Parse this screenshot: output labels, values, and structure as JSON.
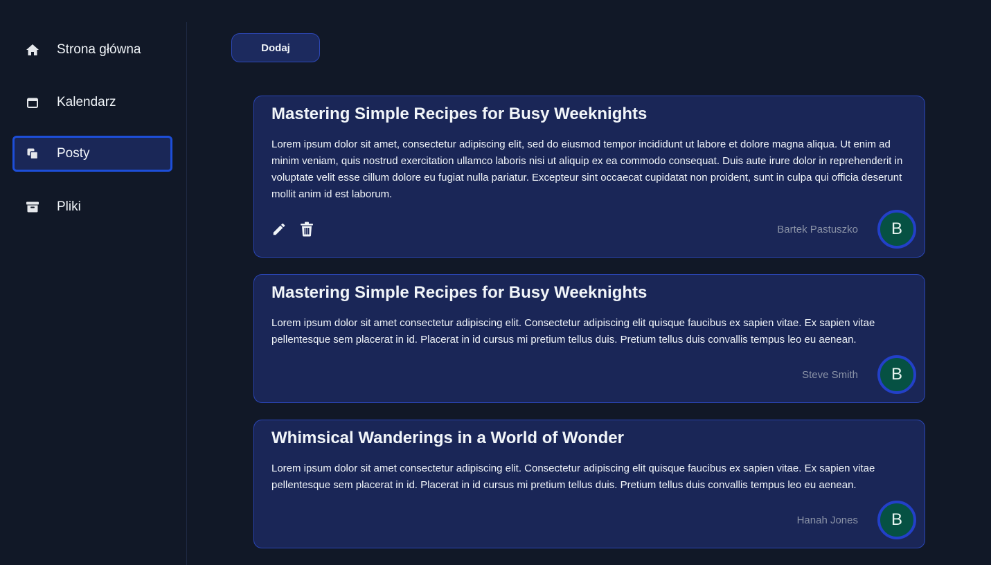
{
  "sidebar": {
    "items": [
      {
        "label": "Strona główna",
        "icon": "home-icon"
      },
      {
        "label": "Kalendarz",
        "icon": "calendar-icon"
      },
      {
        "label": "Posty",
        "icon": "copy-icon",
        "active": true
      },
      {
        "label": "Pliki",
        "icon": "archive-icon"
      }
    ]
  },
  "toolbar": {
    "add_label": "Dodaj"
  },
  "posts": [
    {
      "title": "Mastering Simple Recipes for Busy Weeknights",
      "body": "Lorem ipsum dolor sit amet, consectetur adipiscing elit, sed do eiusmod tempor incididunt ut labore et dolore magna aliqua. Ut enim ad minim veniam, quis nostrud exercitation ullamco laboris nisi ut aliquip ex ea commodo consequat. Duis aute irure dolor in reprehenderit in voluptate velit esse cillum dolore eu fugiat nulla pariatur. Excepteur sint occaecat cupidatat non proident, sunt in culpa qui officia deserunt mollit anim id est laborum.",
      "author": "Bartek Pastuszko",
      "avatar_letter": "B",
      "editable": true
    },
    {
      "title": "Mastering Simple Recipes for Busy Weeknights",
      "body": "Lorem ipsum dolor sit amet consectetur adipiscing elit. Consectetur adipiscing elit quisque faucibus ex sapien vitae. Ex sapien vitae pellentesque sem placerat in id. Placerat in id cursus mi pretium tellus duis. Pretium tellus duis convallis tempus leo eu aenean.",
      "author": "Steve Smith",
      "avatar_letter": "B",
      "editable": false
    },
    {
      "title": "Whimsical Wanderings in a World of Wonder",
      "body": "Lorem ipsum dolor sit amet consectetur adipiscing elit. Consectetur adipiscing elit quisque faucibus ex sapien vitae. Ex sapien vitae pellentesque sem placerat in id. Placerat in id cursus mi pretium tellus duis. Pretium tellus duis convallis tempus leo eu aenean.",
      "author": "Hanah Jones",
      "avatar_letter": "B",
      "editable": false
    }
  ],
  "colors": {
    "background": "#111827",
    "card": "#1a2657",
    "accent": "#1d4ed8",
    "avatar": "#065143"
  }
}
